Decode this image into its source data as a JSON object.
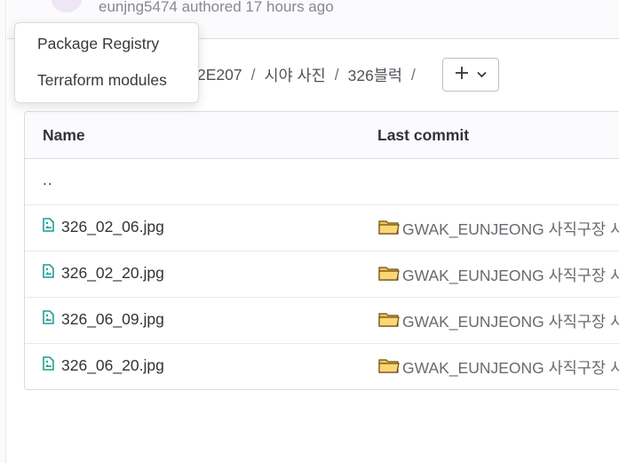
{
  "commit": {
    "author_text": "eunjng5474 authored 17 hours ago"
  },
  "breadcrumb": {
    "items": [
      "2E207",
      "시야 사진",
      "326블럭"
    ],
    "separator": "/"
  },
  "add_button": {
    "plus": "+",
    "chevron": "⌄"
  },
  "table": {
    "headers": {
      "name": "Name",
      "last_commit": "Last commit"
    },
    "parent_dir": "..",
    "rows": [
      {
        "name": "326_02_06.jpg",
        "commit": "GWAK_EUNJEONG 사직구장 시"
      },
      {
        "name": "326_02_20.jpg",
        "commit": "GWAK_EUNJEONG 사직구장 시"
      },
      {
        "name": "326_06_09.jpg",
        "commit": "GWAK_EUNJEONG 사직구장 시"
      },
      {
        "name": "326_06_20.jpg",
        "commit": "GWAK_EUNJEONG 사직구장 시"
      }
    ]
  },
  "dropdown": {
    "items": [
      "Package Registry",
      "Terraform modules"
    ]
  },
  "colors": {
    "file_icon": "#1f9e8f",
    "folder_fill": "#f6c453",
    "folder_stroke": "#6b4e12",
    "avatar": "#c97fd6"
  }
}
